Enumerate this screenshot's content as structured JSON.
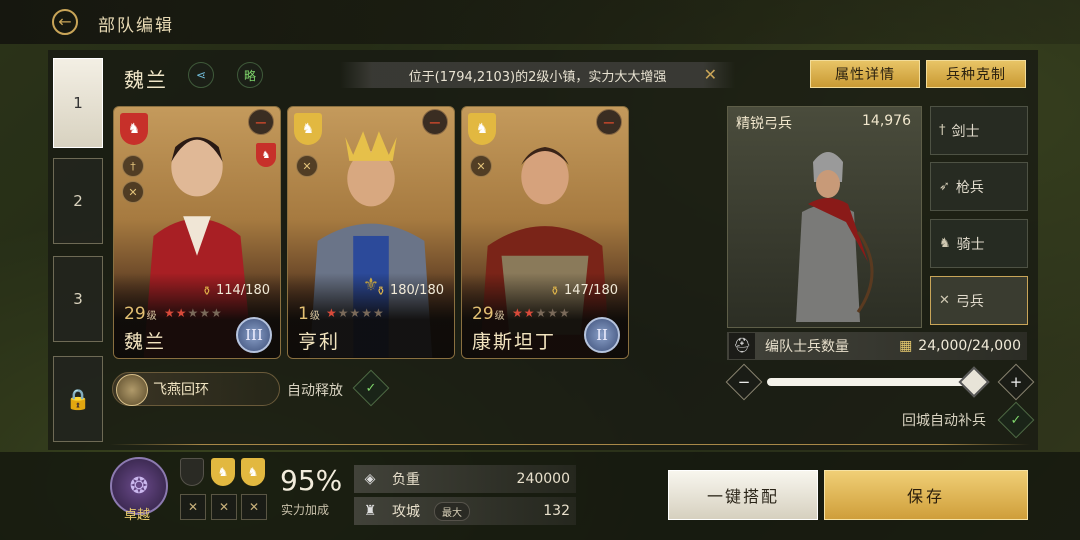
{
  "header": {
    "title": "部队编辑"
  },
  "side_tabs": [
    {
      "label": "1"
    },
    {
      "label": "2"
    },
    {
      "label": "3"
    }
  ],
  "troop": {
    "name": "魏兰",
    "share_icon": "share-icon",
    "strategy_label": "略"
  },
  "notice": {
    "text": "位于(1794,2103)的2级小镇，实力大大增强"
  },
  "buttons": {
    "attr_details": "属性详情",
    "counter": "兵种克制",
    "auto_match": "一键搭配",
    "save": "保存"
  },
  "heroes": [
    {
      "name": "魏兰",
      "level": "29",
      "level_unit": "级",
      "leadership": "114/180",
      "stars": 5,
      "stars_lit": 2,
      "rank": "III",
      "faction_color": "#c7302a"
    },
    {
      "name": "亨利",
      "level": "1",
      "level_unit": "级",
      "leadership": "180/180",
      "stars": 5,
      "stars_lit": 1,
      "rank": "",
      "faction_color": "#e2b840"
    },
    {
      "name": "康斯坦丁",
      "level": "29",
      "level_unit": "级",
      "leadership": "147/180",
      "stars": 5,
      "stars_lit": 2,
      "rank": "II",
      "faction_color": "#e2b840"
    }
  ],
  "skill": {
    "name": "飞燕回环",
    "auto_cast": "自动释放"
  },
  "unit": {
    "name": "精锐弓兵",
    "count": "14,976"
  },
  "unit_tabs": [
    {
      "label": "剑士",
      "icon": "sword-icon"
    },
    {
      "label": "枪兵",
      "icon": "spear-icon"
    },
    {
      "label": "骑士",
      "icon": "horse-icon"
    },
    {
      "label": "弓兵",
      "icon": "bow-icon"
    }
  ],
  "soldiers": {
    "label": "编队士兵数量",
    "value": "24,000/24,000",
    "fill": 1.0
  },
  "auto_refill": {
    "label": "回城自动补兵"
  },
  "formation": {
    "tier": "卓越",
    "power_pct": "95%",
    "power_label": "实力加成"
  },
  "stats": {
    "load_label": "负重",
    "load_value": "240000",
    "siege_label": "攻城",
    "siege_tag": "最大",
    "siege_value": "132"
  },
  "colors": {
    "gold": "#c9a558",
    "green_check": "#7fd66b",
    "star_red": "#d94a3a"
  }
}
